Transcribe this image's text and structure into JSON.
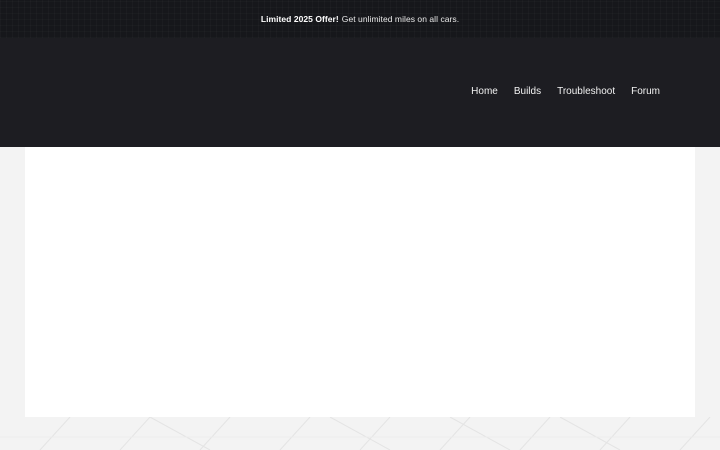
{
  "promo": {
    "highlight": "Limited 2025 Offer!",
    "text": "Get unlimited miles on all cars."
  },
  "nav": {
    "items": [
      {
        "label": "Home"
      },
      {
        "label": "Builds"
      },
      {
        "label": "Troubleshoot"
      },
      {
        "label": "Forum"
      }
    ]
  },
  "colors": {
    "topbar": "#16171b",
    "header": "#1d1d22",
    "page_background": "#f3f3f3",
    "content": "#ffffff"
  }
}
